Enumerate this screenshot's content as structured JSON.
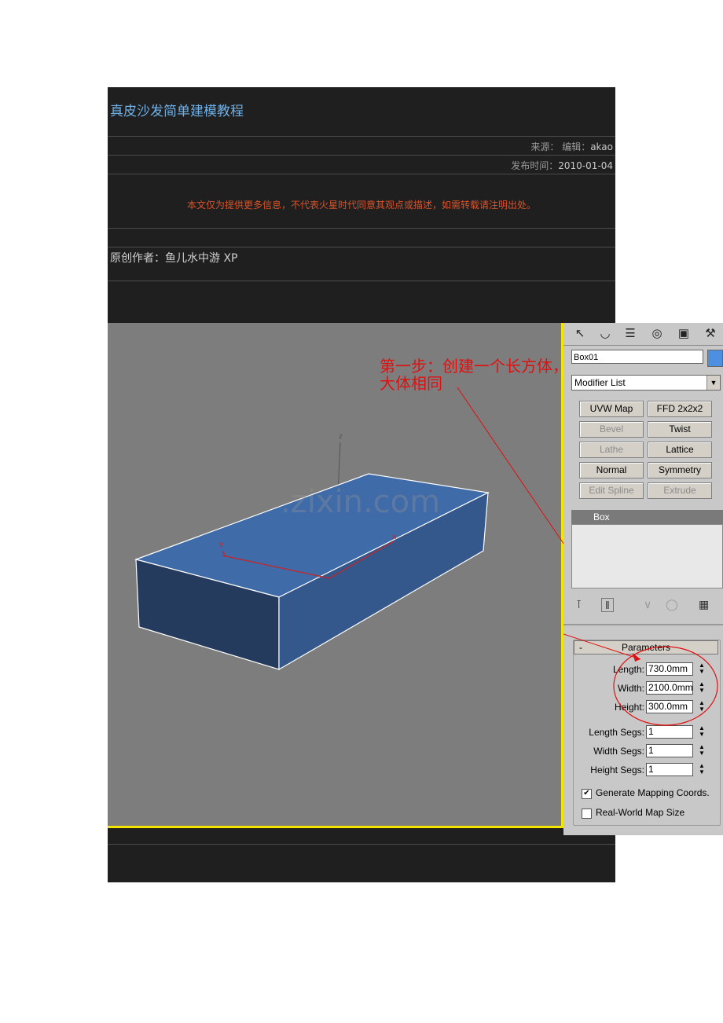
{
  "article": {
    "title": "真皮沙发简单建模教程",
    "source_label": "来源：",
    "editor_label": "编辑：",
    "editor_value": "akao",
    "date_label": "发布时间：",
    "date_value": "2010-01-04",
    "notice": "本文仅为提供更多信息，不代表火星时代同意其观点或描述，如需转载请注明出处。",
    "author": "原创作者：鱼儿水中游 XP"
  },
  "viewport": {
    "annotation_line1": "第一步：创建一个长方体，尺寸和沙发",
    "annotation_line2": "大体相同",
    "watermark": ".zixin.com",
    "axis_z": "z",
    "axis_y": "y",
    "axis_x": "x",
    "highlight_color": "#f2e600",
    "box_color": "#3d6aa6"
  },
  "panel": {
    "tab_icons": [
      "create-icon",
      "modify-icon",
      "hierarchy-icon",
      "motion-icon",
      "display-icon",
      "utilities-icon"
    ],
    "object_name": "Box01",
    "modifier_list": "Modifier List",
    "modifier_buttons": [
      {
        "label": "UVW Map",
        "enabled": true
      },
      {
        "label": "FFD 2x2x2",
        "enabled": true
      },
      {
        "label": "Bevel",
        "enabled": false
      },
      {
        "label": "Twist",
        "enabled": true
      },
      {
        "label": "Lathe",
        "enabled": false
      },
      {
        "label": "Lattice",
        "enabled": true
      },
      {
        "label": "Normal",
        "enabled": true
      },
      {
        "label": "Symmetry",
        "enabled": true
      },
      {
        "label": "Edit Spline",
        "enabled": false
      },
      {
        "label": "Extrude",
        "enabled": false
      }
    ],
    "stack_item": "Box",
    "params_title": "Parameters",
    "params_collapse": "-",
    "length_label": "Length:",
    "length_value": "730.0mm",
    "width_label": "Width:",
    "width_value": "2100.0mm",
    "height_label": "Height:",
    "height_value": "300.0mm",
    "length_segs_label": "Length Segs:",
    "length_segs_value": "1",
    "width_segs_label": "Width Segs:",
    "width_segs_value": "1",
    "height_segs_label": "Height Segs:",
    "height_segs_value": "1",
    "gen_mapping_label": "Generate Mapping Coords.",
    "gen_mapping_checked": true,
    "real_world_label": "Real-World Map Size",
    "real_world_checked": false
  }
}
